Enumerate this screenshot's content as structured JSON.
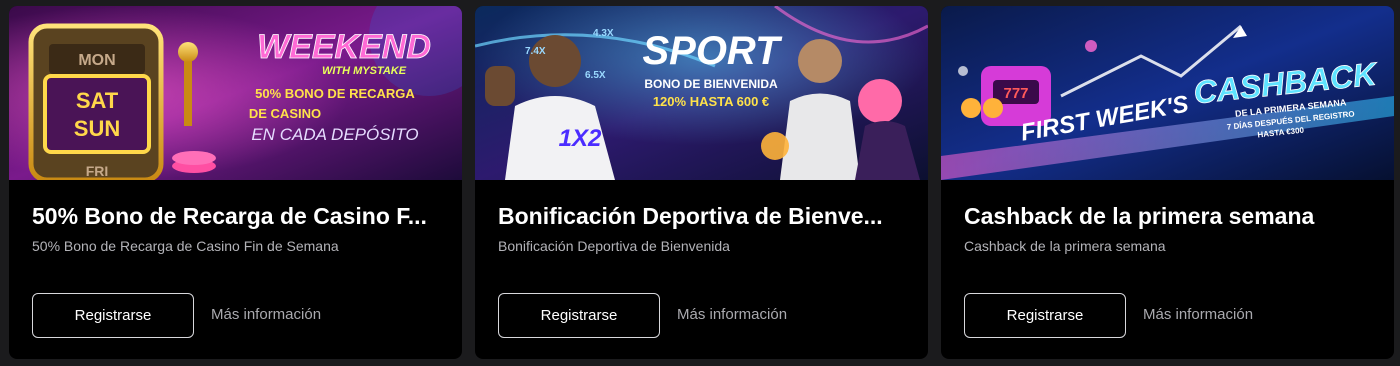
{
  "cards": [
    {
      "title": "50% Bono de Recarga de Casino F...",
      "subtitle": "50% Bono de Recarga de Casino Fin de Semana",
      "register_label": "Registrarse",
      "more_label": "Más información",
      "banner": {
        "reel_top": "MON",
        "reel_main_1": "SAT",
        "reel_main_2": "SUN",
        "reel_bottom": "FRI",
        "headline": "WEEKEND",
        "tagline": "WITH MYSTAKE",
        "line1": "50% BONO DE RECARGA",
        "line2": "DE CASINO",
        "line3": "EN CADA DEPÓSITO"
      }
    },
    {
      "title": "Bonificación Deportiva de Bienve...",
      "subtitle": "Bonificación Deportiva de Bienvenida",
      "register_label": "Registrarse",
      "more_label": "Más información",
      "banner": {
        "headline": "SPORT",
        "line1": "BONO DE BIENVENIDA",
        "line2": "120% HASTA 600 €",
        "odd1": "7.4X",
        "odd2": "4.3X",
        "odd3": "6.5X",
        "shirt_text": "1X2"
      }
    },
    {
      "title": "Cashback de la primera semana",
      "subtitle": "Cashback de la primera semana",
      "register_label": "Registrarse",
      "more_label": "Más información",
      "banner": {
        "slot_text": "777",
        "road_text": "FIRST WEEK'S",
        "headline": "CASHBACK",
        "line1": "DE LA PRIMERA SEMANA",
        "line2": "7 DÍAS DESPUÉS DEL REGISTRO",
        "line3": "HASTA €300"
      }
    }
  ],
  "colors": {
    "page_bg": "#1b1b1d",
    "card_bg": "#000000",
    "title": "#ffffff",
    "subtitle": "#b3b3b8",
    "button_border": "#d8d8dc",
    "link": "#a9a9ae"
  }
}
